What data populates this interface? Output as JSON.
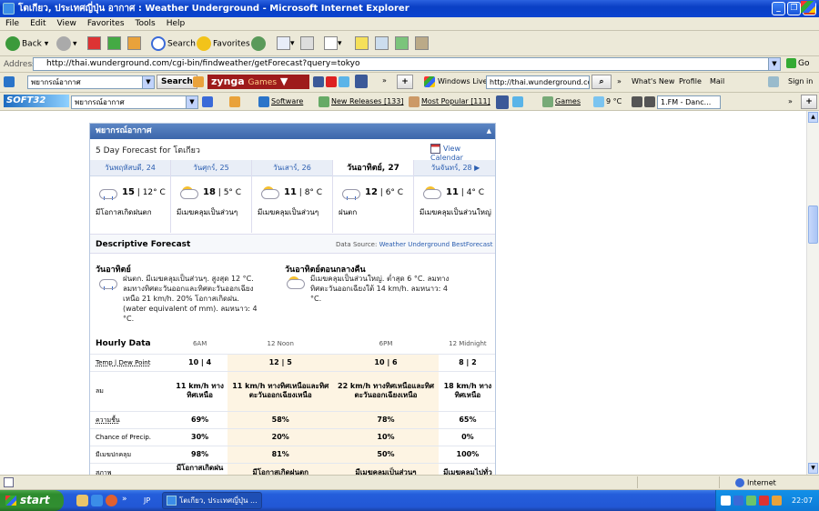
{
  "window": {
    "title": "โตเกียว, ประเทศญี่ปุ่น อากาศ : Weather Underground - Microsoft Internet Explorer"
  },
  "menu": [
    "File",
    "Edit",
    "View",
    "Favorites",
    "Tools",
    "Help"
  ],
  "toolbar": {
    "back": "Back",
    "search": "Search",
    "favorites": "Favorites"
  },
  "address": {
    "label": "Address",
    "url": "http://thai.wunderground.com/cgi-bin/findweather/getForecast?query=tokyo",
    "go": "Go"
  },
  "links_bar": {
    "search_field": "พยากรณ์อากาศ",
    "search_button": "Search",
    "zynga": "zynga",
    "zynga_games": "Games",
    "windows_live": "Windows Live",
    "live_url": "http://thai.wunderground.com/c",
    "whats_new": "What's New",
    "profile": "Profile",
    "mail": "Mail",
    "sign_in": "Sign in"
  },
  "soft_bar": {
    "logo": "SOFT32",
    "search_field": "พยากรณ์อากาศ",
    "software": "Software",
    "new_releases": "New Releases",
    "new_releases_count": "[133]",
    "most_popular": "Most Popular",
    "most_popular_count": "[111]",
    "games": "Games",
    "temp": "9 °C",
    "radio": "1.FM - Danc..."
  },
  "forecast": {
    "header": "พยากรณ์อากาศ",
    "subtitle": "5 Day Forecast for โตเกียว",
    "view_calendar": "View Calendar",
    "days": [
      {
        "name": "วันพฤหัสบดี, 24",
        "high": "15",
        "low": "12° C",
        "cond": "มีโอกาสเกิดฝนตก"
      },
      {
        "name": "วันศุกร์, 25",
        "high": "18",
        "low": "5° C",
        "cond": "มีเมฆคลุมเป็นส่วนๆ"
      },
      {
        "name": "วันเสาร์, 26",
        "high": "11",
        "low": "8° C",
        "cond": "มีเมฆคลุมเป็นส่วนๆ"
      },
      {
        "name": "วันอาทิตย์, 27",
        "high": "12",
        "low": "6° C",
        "cond": "ฝนตก"
      },
      {
        "name": "วันจันทร์, 28",
        "high": "11",
        "low": "4° C",
        "cond": "มีเมฆคลุมเป็นส่วนใหญ่"
      }
    ],
    "desc_title": "Descriptive Forecast",
    "desc_source_label": "Data Source:",
    "desc_source": "Weather Underground BestForecast",
    "desc_left_title": "วันอาทิตย์",
    "desc_left_text": "ฝนตก. มีเมฆคลุมเป็นส่วนๆ. สูงสุด 12 °C. ลมทางทิศตะวันออกและทิศตะวันออกเฉียงเหนือ 21 km/h. 20% โอกาสเกิดฝน. (water equivalent of mm). ลมหนาว: 4 °C.",
    "desc_right_title": "วันอาทิตย์ตอนกลางคืน",
    "desc_right_text": "มีเมฆคลุมเป็นส่วนใหญ่. ต่ำสุด 6 °C. ลมทางทิศตะวันออกเฉียงใต้ 14 km/h. ลมหนาว: 4 °C."
  },
  "hourly": {
    "title": "Hourly Data",
    "times": [
      "6AM",
      "12 Noon",
      "6PM",
      "12 Midnight"
    ],
    "rows": [
      {
        "label": "Temp | Dew Point",
        "cells": [
          "10 | 4",
          "12 | 5",
          "10 | 6",
          "8 | 2"
        ]
      },
      {
        "label": "ลม",
        "cells": [
          "11 km/h ทางทิศเหนือ",
          "11 km/h ทางทิศเหนือและทิศตะวันออกเฉียงเหนือ",
          "22 km/h ทางทิศเหนือและทิศตะวันออกเฉียงเหนือ",
          "18 km/h ทางทิศเหนือ"
        ]
      },
      {
        "label": "ความชื้น",
        "cells": [
          "69%",
          "58%",
          "78%",
          "65%"
        ]
      },
      {
        "label": "Chance of Precip.",
        "cells": [
          "30%",
          "20%",
          "10%",
          "0%"
        ]
      },
      {
        "label": "มีเมฆปกคลุม",
        "cells": [
          "98%",
          "81%",
          "50%",
          "100%"
        ]
      },
      {
        "label": "สภาพ",
        "cells": [
          "มีโอกาสเกิดฝนตก",
          "มีโอกาสเกิดฝนตก",
          "มีเมฆคลุมเป็นส่วนๆ",
          "มีเมฆคลุมไปทั่ว"
        ]
      }
    ]
  },
  "status": {
    "zone": "Internet"
  },
  "taskbar": {
    "start": "start",
    "lang": "JP",
    "task": "โตเกียว, ประเทศญี่ปุ่น ...",
    "clock": "22:07"
  }
}
